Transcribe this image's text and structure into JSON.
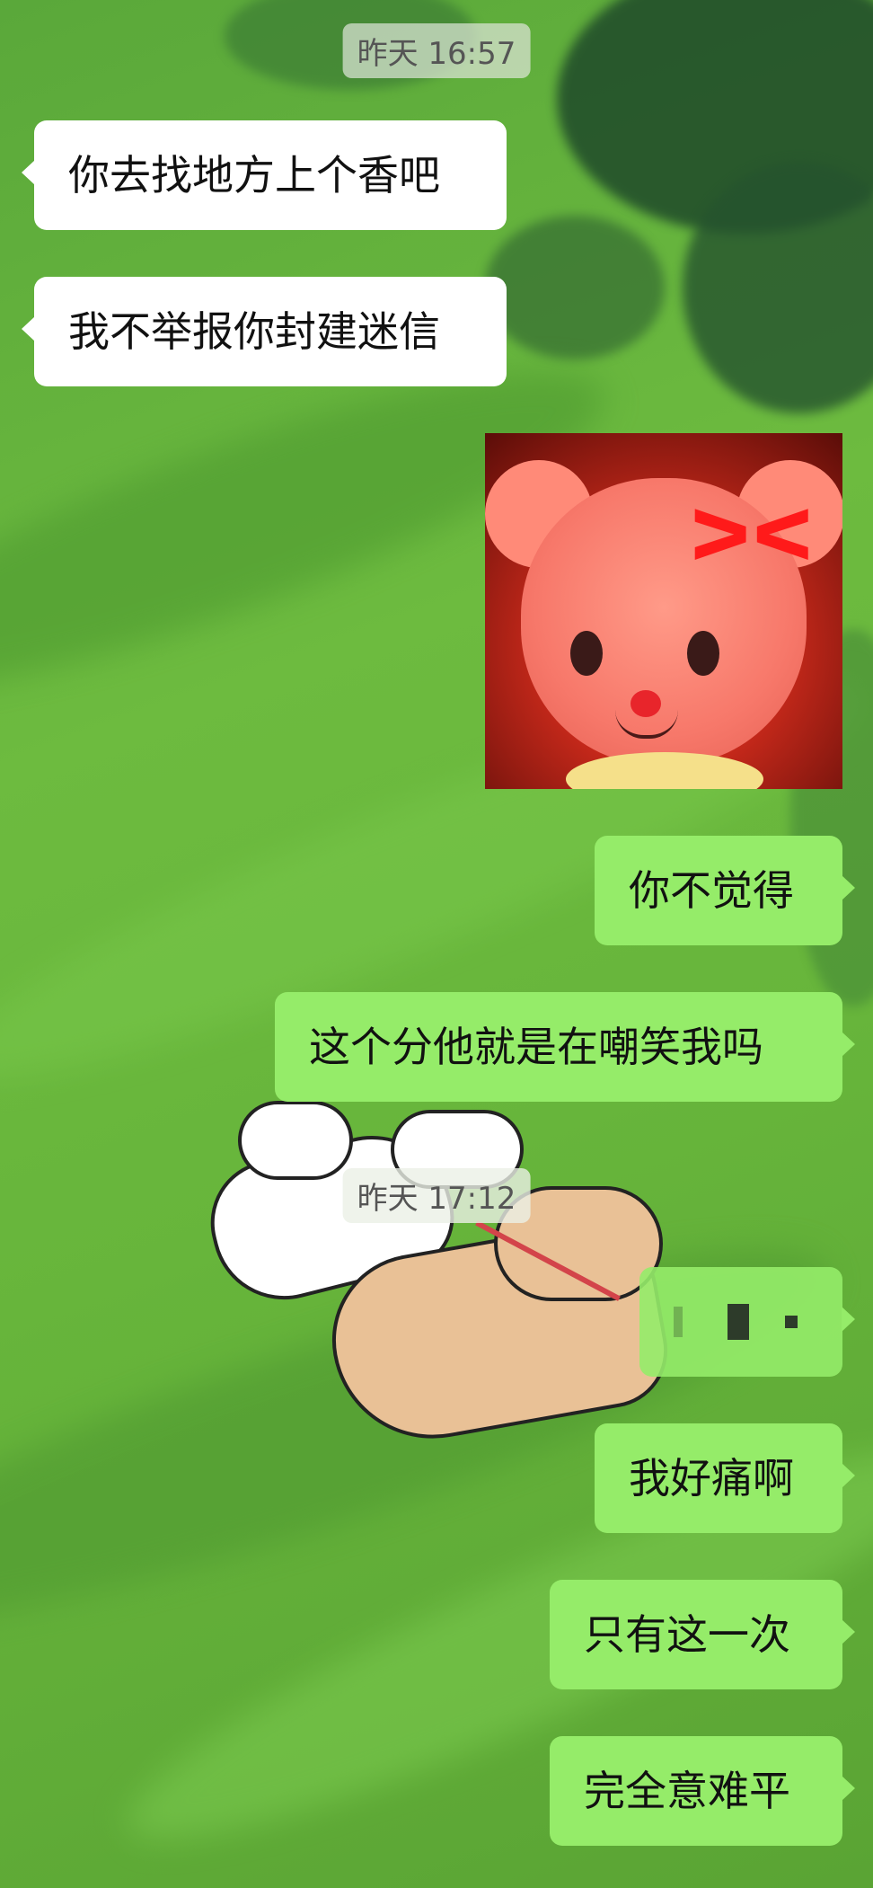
{
  "background": {
    "colors": {
      "base": "#6dbb3f",
      "foliage": "#1f4a2a",
      "incoming_bubble": "#ffffff",
      "outgoing_bubble": "#95ec69"
    }
  },
  "messages": [
    {
      "type": "timestamp",
      "text": "昨天 16:57"
    },
    {
      "type": "incoming",
      "text": "你去找地方上个香吧"
    },
    {
      "type": "incoming",
      "text": "我不举报你封建迷信"
    },
    {
      "type": "outgoing_sticker",
      "sticker": "angry-red-bear-sticker"
    },
    {
      "type": "outgoing",
      "text": "你不觉得"
    },
    {
      "type": "outgoing",
      "text": "这个分他就是在嘲笑我吗"
    },
    {
      "type": "timestamp",
      "text": "昨天 17:12"
    },
    {
      "type": "outgoing",
      "text": "",
      "note_visible": "pixelated-content"
    },
    {
      "type": "outgoing",
      "text": "我好痛啊"
    },
    {
      "type": "outgoing",
      "text": "只有这一次"
    },
    {
      "type": "outgoing",
      "text": "完全意难平"
    }
  ]
}
